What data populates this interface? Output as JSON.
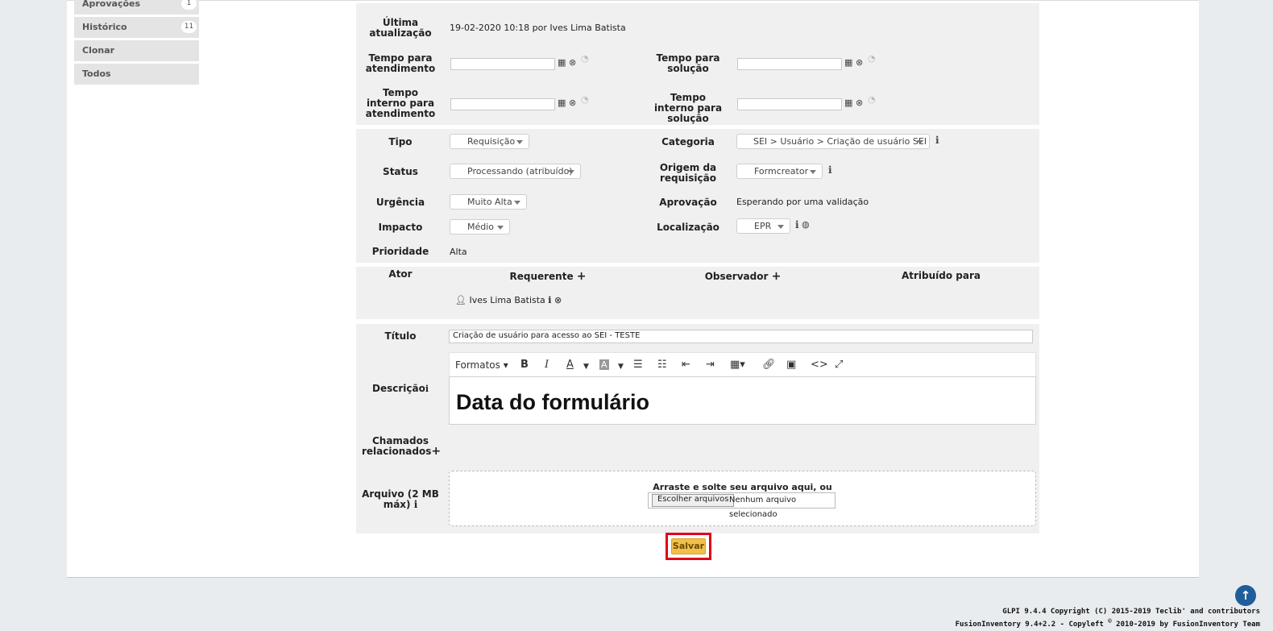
{
  "sidebar": {
    "items": [
      {
        "label": "Aprovações",
        "count": "1"
      },
      {
        "label": "Histórico",
        "count": "11"
      },
      {
        "label": "Clonar",
        "count": ""
      },
      {
        "label": "Todos",
        "count": ""
      }
    ]
  },
  "dates": {
    "last_update_label": "Última atualização",
    "last_update_value": "19-02-2020 10:18 por Ives Lima Batista",
    "tta_label": "Tempo para atendimento",
    "ttr_label": "Tempo para solução",
    "internal_tta_label": "Tempo interno para atendimento",
    "internal_ttr_label": "Tempo interno para solução"
  },
  "fields": {
    "tipo_label": "Tipo",
    "tipo_value": "Requisição",
    "categoria_label": "Categoria",
    "categoria_value": "SEI > Usuário > Criação de usuário SEI",
    "status_label": "Status",
    "status_value": "Processando (atribuído)",
    "origem_label": "Origem da requisição",
    "origem_value": "Formcreator",
    "urgencia_label": "Urgência",
    "urgencia_value": "Muito Alta",
    "aprovacao_label": "Aprovação",
    "aprovacao_value": "Esperando por uma validação",
    "impacto_label": "Impacto",
    "impacto_value": "Médio",
    "localizacao_label": "Localização",
    "localizacao_value": "EPR",
    "prioridade_label": "Prioridade",
    "prioridade_value": "Alta"
  },
  "actors": {
    "label": "Ator",
    "requester_label": "Requerente",
    "observer_label": "Observador",
    "assigned_label": "Atribuído para",
    "requester_name": "Ives Lima Batista"
  },
  "content": {
    "title_label": "Título",
    "title_value": "Criação de usuário para acesso ao SEI - TESTE",
    "description_label": "Descrição",
    "formats_label": "Formatos",
    "editor_heading": "Data do formulário",
    "linked_label": "Chamados relacionados",
    "file_label": "Arquivo (2 MB máx)",
    "drop_text": "Arraste e solte seu arquivo aqui, ou",
    "choose_button": "Escolher arquivos",
    "no_file": "Nenhum arquivo selecionado"
  },
  "actions": {
    "save_label": "Salvar"
  },
  "footer": {
    "line1": "GLPI 9.4.4 Copyright (C) 2015-2019 Teclib' and contributors",
    "line2_prefix": "FusionInventory 9.4+2.2 - Copyleft ",
    "line2_symbol": "©",
    "line2_suffix": " 2010-2019 by FusionInventory Team"
  },
  "colors": {
    "save_bg": "#f2c04a",
    "highlight": "#e0001a",
    "scroll_top": "#1f5e9a"
  }
}
